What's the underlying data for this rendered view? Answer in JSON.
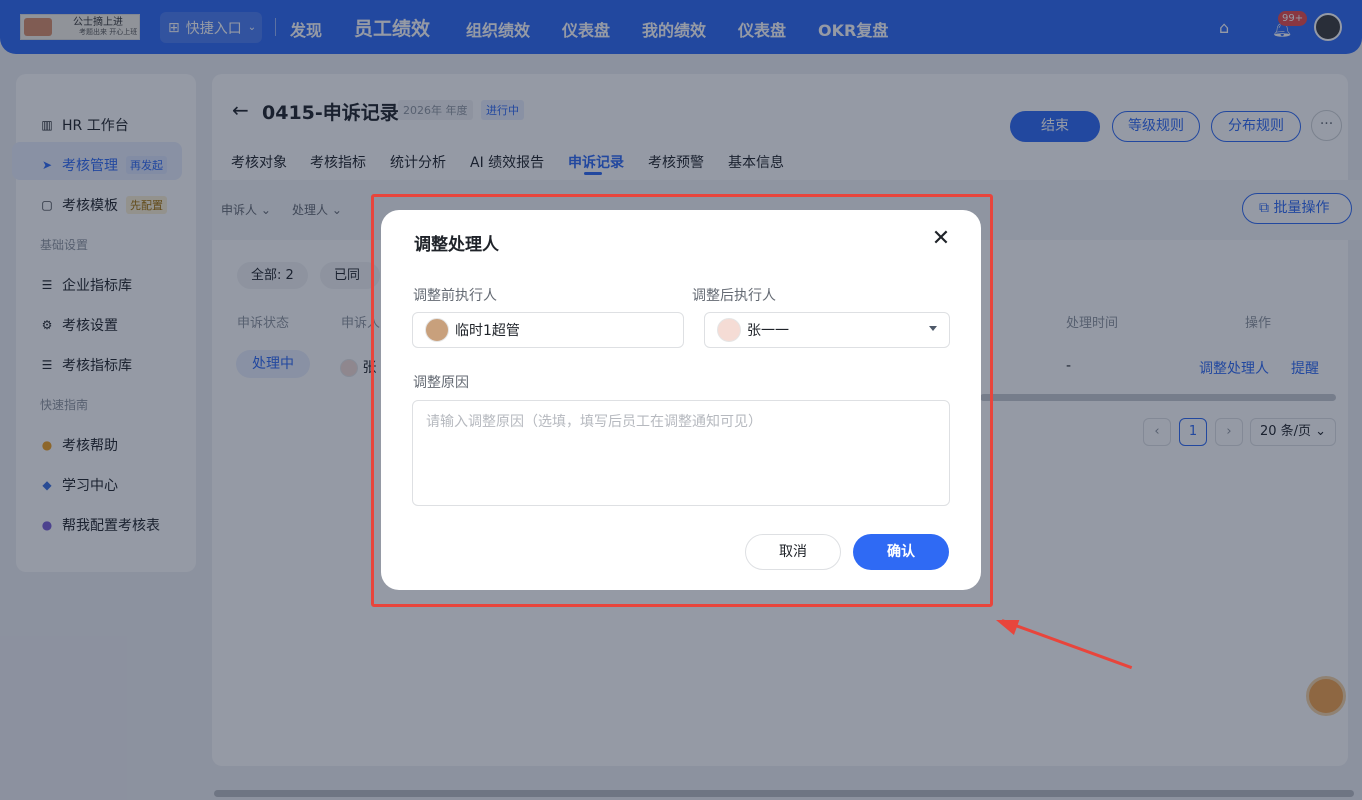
{
  "topbar": {
    "logo_line1": "公士摘上进",
    "logo_line2": "考题出来 开心上班",
    "quick_entry": "快捷入口",
    "nav": [
      "发现",
      "员工绩效",
      "组织绩效",
      "仪表盘",
      "我的绩效",
      "仪表盘",
      "OKR复盘"
    ],
    "notif_badge": "99+"
  },
  "sidebar": {
    "items": [
      {
        "label": "HR 工作台"
      },
      {
        "label": "考核管理",
        "tag": "再发起"
      },
      {
        "label": "考核模板",
        "tag": "先配置"
      }
    ],
    "section_basic": "基础设置",
    "basic_items": [
      "企业指标库",
      "考核设置",
      "考核指标库"
    ],
    "section_guide": "快速指南",
    "guide_items": [
      "考核帮助",
      "学习中心",
      "帮我配置考核表"
    ]
  },
  "header": {
    "title": "0415-申诉记录",
    "year": "2026年 年度",
    "status": "进行中",
    "btn_end": "结束",
    "btn_grade": "等级规则",
    "btn_dist": "分布规则",
    "btn_more": "···"
  },
  "tabs": [
    "考核对象",
    "考核指标",
    "统计分析",
    "AI 绩效报告",
    "申诉记录",
    "考核预警",
    "基本信息"
  ],
  "filters": {
    "appellant": "申诉人",
    "handler": "处理人",
    "batch": "批量操作"
  },
  "chips": {
    "all": "全部: 2",
    "agreed": "已同意"
  },
  "table": {
    "headers": {
      "status": "申诉状态",
      "appellant": "申诉人",
      "handle_time": "处理时间",
      "ops": "操作"
    },
    "row": {
      "status": "处理中",
      "appellant": "张",
      "handle_time": "-",
      "op1": "调整处理人",
      "op2": "提醒"
    }
  },
  "pager": {
    "prev": "‹",
    "page": "1",
    "next": "›",
    "size": "20 条/页"
  },
  "dialog": {
    "title": "调整处理人",
    "before_label": "调整前执行人",
    "before_value": "临时1超管",
    "after_label": "调整后执行人",
    "after_value": "张一一",
    "reason_label": "调整原因",
    "reason_placeholder": "请输入调整原因（选填，填写后员工在调整通知可见）",
    "cancel": "取消",
    "confirm": "确认"
  },
  "colors": {
    "brand": "#2f6af4",
    "annotation": "#e8453c"
  }
}
